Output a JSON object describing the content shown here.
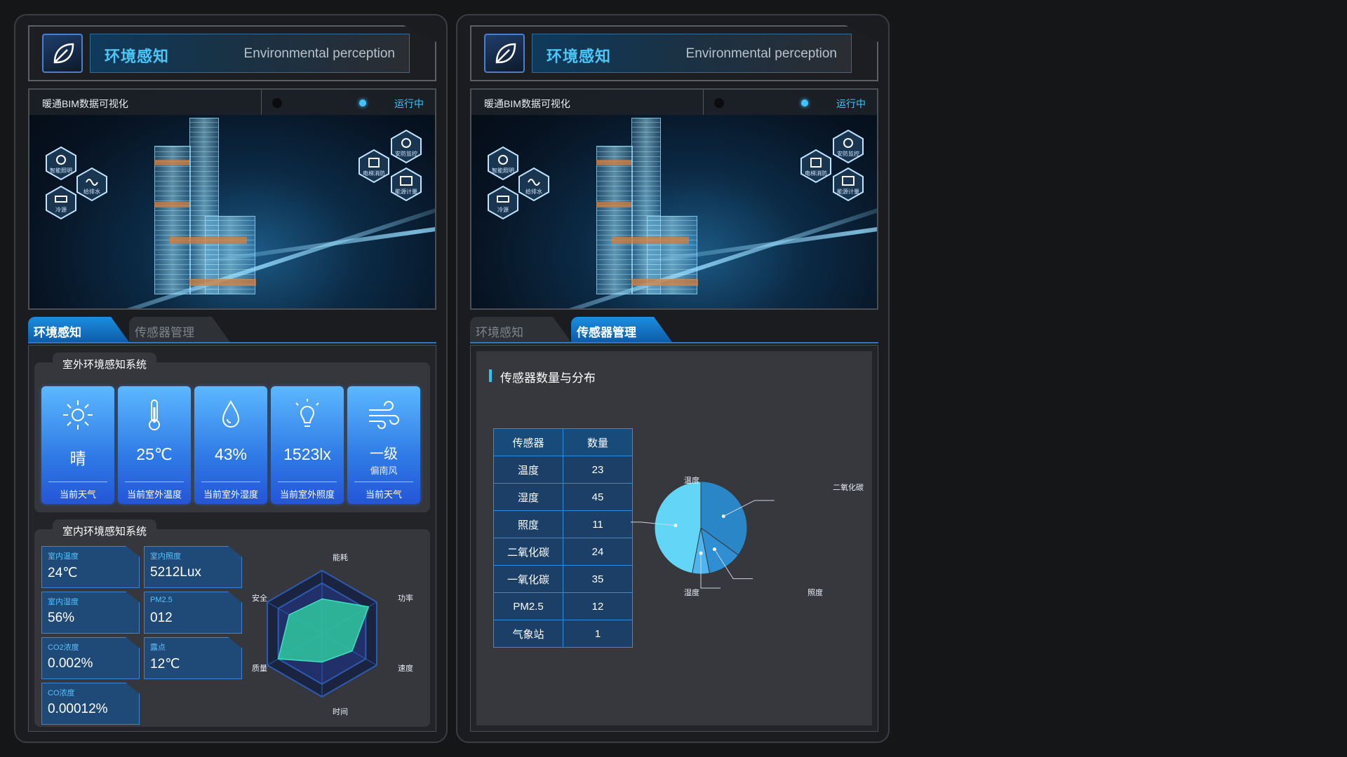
{
  "panels": [
    {
      "header": {
        "title": "环境感知",
        "subtitle": "Environmental perception"
      },
      "scene": {
        "label": "暖通BIM数据可视化",
        "status": "运行中",
        "hex_labels": [
          "智能照明",
          "给排水",
          "冷源",
          "电梯消防",
          "安防监控",
          "能源计量"
        ]
      },
      "tabs": [
        {
          "label": "环境感知",
          "active": true
        },
        {
          "label": "传感器管理",
          "active": false
        }
      ]
    },
    {
      "header": {
        "title": "环境感知",
        "subtitle": "Environmental perception"
      },
      "scene": {
        "label": "暖通BIM数据可视化",
        "status": "运行中",
        "hex_labels": [
          "智能照明",
          "给排水",
          "冷源",
          "电梯消防",
          "安防监控",
          "能源计量"
        ]
      },
      "tabs": [
        {
          "label": "环境感知",
          "active": false
        },
        {
          "label": "传感器管理",
          "active": true
        }
      ]
    }
  ],
  "outdoor": {
    "title": "室外环境感知系统",
    "cards": [
      {
        "icon": "sun-icon",
        "value": "晴",
        "sub": "",
        "label": "当前天气"
      },
      {
        "icon": "thermometer-icon",
        "value": "25℃",
        "sub": "",
        "label": "当前室外温度"
      },
      {
        "icon": "droplet-icon",
        "value": "43%",
        "sub": "",
        "label": "当前室外湿度"
      },
      {
        "icon": "bulb-icon",
        "value": "1523lx",
        "sub": "",
        "label": "当前室外照度"
      },
      {
        "icon": "wind-icon",
        "value": "一级",
        "sub": "偏南风",
        "label": "当前天气"
      }
    ]
  },
  "indoor": {
    "title": "室内环境感知系统",
    "metrics": [
      {
        "label": "室内温度",
        "value": "24℃"
      },
      {
        "label": "室内照度",
        "value": "5212Lux"
      },
      {
        "label": "室内湿度",
        "value": "56%"
      },
      {
        "label": "PM2.5",
        "value": "012"
      },
      {
        "label": "CO2浓度",
        "value": "0.002%"
      },
      {
        "label": "露点",
        "value": "12℃"
      },
      {
        "label": "CO浓度",
        "value": "0.00012%"
      }
    ],
    "radar": {
      "axes": [
        "能耗",
        "功率",
        "速度",
        "时间",
        "质量",
        "安全"
      ],
      "values": [
        0.55,
        0.85,
        0.55,
        0.45,
        0.8,
        0.6
      ],
      "max": 1
    }
  },
  "sensors": {
    "title": "传感器数量与分布",
    "columns": [
      "传感器",
      "数量"
    ],
    "rows": [
      [
        "温度",
        "23"
      ],
      [
        "湿度",
        "45"
      ],
      [
        "照度",
        "11"
      ],
      [
        "二氧化碳",
        "24"
      ],
      [
        "一氧化碳",
        "35"
      ],
      [
        "PM2.5",
        "12"
      ],
      [
        "气象站",
        "1"
      ]
    ]
  },
  "chart_data": {
    "type": "pie",
    "slices": [
      {
        "label": "二氧化碳",
        "value": 35,
        "color": "#2b86c8"
      },
      {
        "label": "照度",
        "value": 12,
        "color": "#2f8fd2"
      },
      {
        "label": "湿度",
        "value": 6,
        "color": "#4fb5ee"
      },
      {
        "label": "温度",
        "value": 47,
        "color": "#63d6f8"
      }
    ]
  },
  "colors": {
    "accent": "#4bc6f7",
    "card_gradient_top": "#5cb8ff",
    "card_gradient_bottom": "#2455d8",
    "radar_fill": "#2fc9a0"
  }
}
